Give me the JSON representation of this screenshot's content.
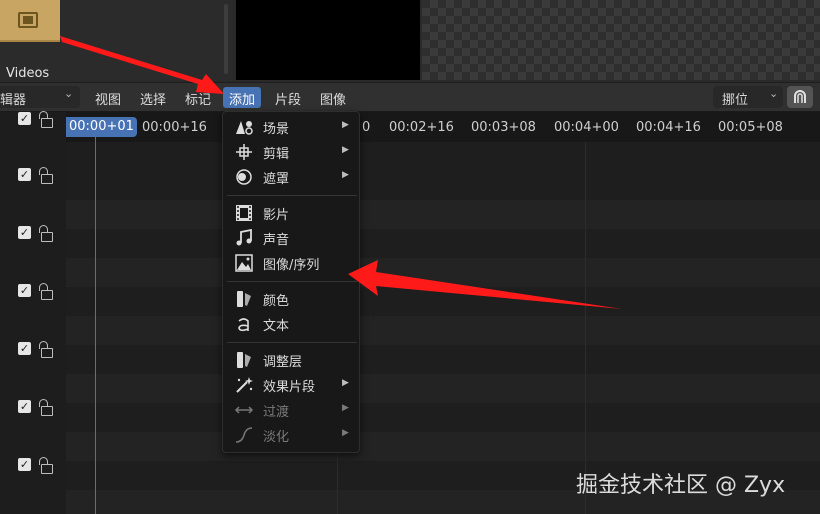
{
  "file_browser": {
    "folder_label": "Videos"
  },
  "header": {
    "editor_type_label": "辑器",
    "menus": [
      "视图",
      "选择",
      "标记",
      "添加",
      "片段",
      "图像"
    ],
    "active_menu": "添加",
    "snap_label": "挪位"
  },
  "timeline": {
    "current_frame": "00:00+01",
    "ticks": [
      "00:00+16",
      "0",
      "00:02+16",
      "00:03+08",
      "00:04+00",
      "00:04+16",
      "00:05+08"
    ]
  },
  "add_menu": {
    "items": [
      {
        "label": "场景",
        "icon": "scene-icon",
        "submenu": true,
        "enabled": true
      },
      {
        "label": "剪辑",
        "icon": "clip-icon",
        "submenu": true,
        "enabled": true
      },
      {
        "label": "遮罩",
        "icon": "mask-icon",
        "submenu": true,
        "enabled": true
      },
      {
        "label": "影片",
        "icon": "movie-icon",
        "submenu": false,
        "enabled": true
      },
      {
        "label": "声音",
        "icon": "sound-icon",
        "submenu": false,
        "enabled": true
      },
      {
        "label": "图像/序列",
        "icon": "image-sequence-icon",
        "submenu": false,
        "enabled": true
      },
      {
        "label": "颜色",
        "icon": "color-icon",
        "submenu": false,
        "enabled": true
      },
      {
        "label": "文本",
        "icon": "text-icon",
        "submenu": false,
        "enabled": true
      },
      {
        "label": "调整层",
        "icon": "adjustment-layer-icon",
        "submenu": false,
        "enabled": true
      },
      {
        "label": "效果片段",
        "icon": "effect-strip-icon",
        "submenu": true,
        "enabled": true
      },
      {
        "label": "过渡",
        "icon": "transition-icon",
        "submenu": true,
        "enabled": false
      },
      {
        "label": "淡化",
        "icon": "fade-icon",
        "submenu": true,
        "enabled": false
      }
    ]
  },
  "watermark": "掘金技术社区 @ Zyx",
  "colors": {
    "accent": "#4772b3",
    "annotation_arrow": "#ff1a1a",
    "thumb": "#c9a563"
  }
}
